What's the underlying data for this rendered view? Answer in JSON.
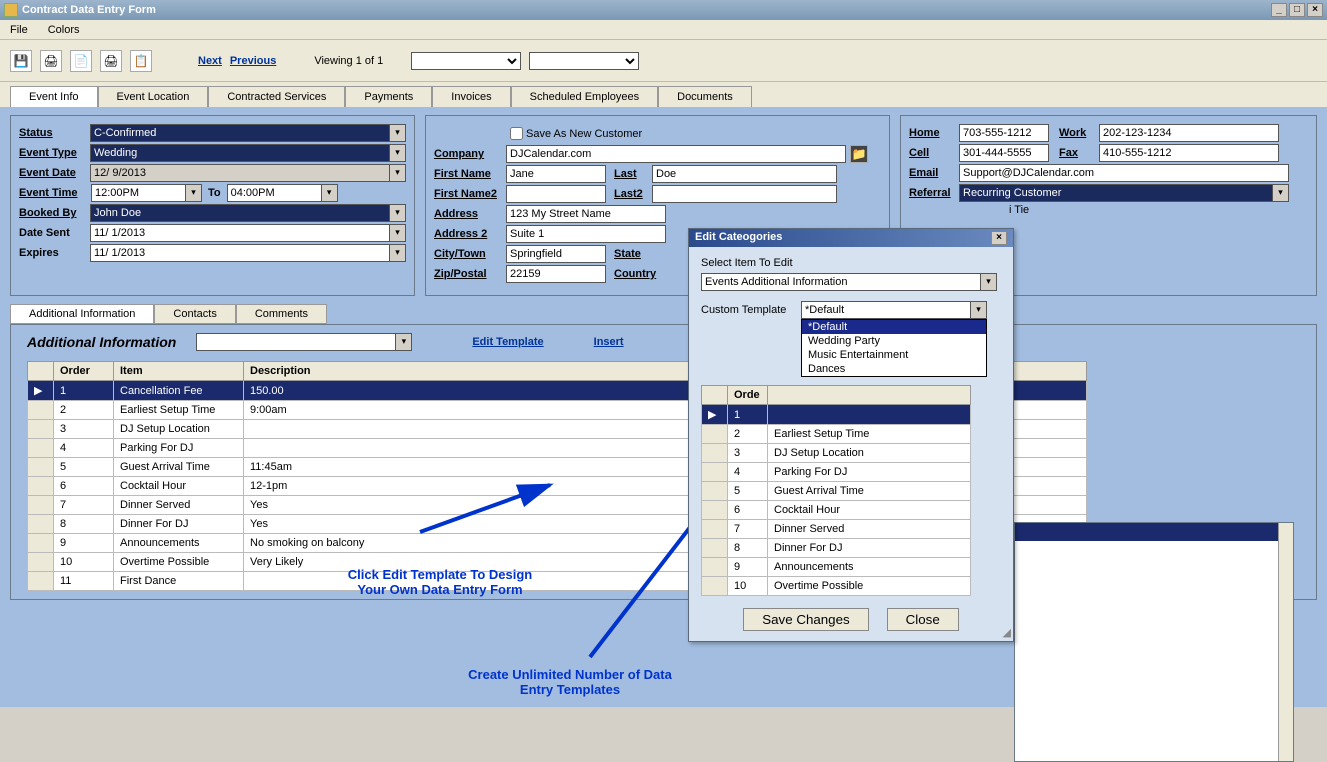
{
  "window": {
    "title": "Contract Data Entry Form"
  },
  "menu": {
    "file": "File",
    "colors": "Colors"
  },
  "toolbar": {
    "next": "Next",
    "previous": "Previous",
    "viewing": "Viewing 1 of 1"
  },
  "tabs": [
    "Event Info",
    "Event Location",
    "Contracted Services",
    "Payments",
    "Invoices",
    "Scheduled Employees",
    "Documents"
  ],
  "left": {
    "status_lbl": "Status",
    "status": "C-Confirmed",
    "eventtype_lbl": "Event Type",
    "eventtype": "Wedding",
    "eventdate_lbl": "Event Date",
    "eventdate": "12/ 9/2013",
    "eventtime_lbl": "Event Time",
    "eventtime_from": "12:00PM",
    "to": "To",
    "eventtime_to": "04:00PM",
    "booked_lbl": "Booked By",
    "booked": "John Doe",
    "datesent_lbl": "Date Sent",
    "datesent": "11/ 1/2013",
    "expires_lbl": "Expires",
    "expires": "11/ 1/2013"
  },
  "mid": {
    "saveas": "Save As New Customer",
    "company_lbl": "Company",
    "company": "DJCalendar.com",
    "first_lbl": "First Name",
    "first": "Jane",
    "last_lbl": "Last",
    "last": "Doe",
    "first2_lbl": "First Name2",
    "first2": "",
    "last2_lbl": "Last2",
    "last2": "",
    "addr_lbl": "Address",
    "addr": "123 My Street Name",
    "addr2_lbl": "Address 2",
    "addr2": "Suite 1",
    "city_lbl": "City/Town",
    "city": "Springfield",
    "state_lbl": "State",
    "zip_lbl": "Zip/Postal",
    "zip": "22159",
    "country_lbl": "Country"
  },
  "right": {
    "home_lbl": "Home",
    "home": "703-555-1212",
    "work_lbl": "Work",
    "work": "202-123-1234",
    "cell_lbl": "Cell",
    "cell": "301-444-5555",
    "fax_lbl": "Fax",
    "fax": "410-555-1212",
    "email_lbl": "Email",
    "email": "Support@DJCalendar.com",
    "referral_lbl": "Referral",
    "referral": "Recurring Customer",
    "tie": "i Tie"
  },
  "subtabs": [
    "Additional Information",
    "Contacts",
    "Comments"
  ],
  "ai": {
    "title": "Additional Information",
    "edit_template": "Edit Template",
    "insert": "Insert",
    "cols": {
      "order": "Order",
      "item": "Item",
      "desc": "Description"
    },
    "rows": [
      {
        "o": "1",
        "i": "Cancellation Fee",
        "d": "150.00"
      },
      {
        "o": "2",
        "i": "Earliest Setup Time",
        "d": "9:00am"
      },
      {
        "o": "3",
        "i": "DJ Setup Location",
        "d": ""
      },
      {
        "o": "4",
        "i": "Parking For DJ",
        "d": ""
      },
      {
        "o": "5",
        "i": "Guest Arrival Time",
        "d": "11:45am"
      },
      {
        "o": "6",
        "i": "Cocktail Hour",
        "d": "12-1pm"
      },
      {
        "o": "7",
        "i": "Dinner Served",
        "d": "Yes"
      },
      {
        "o": "8",
        "i": "Dinner For DJ",
        "d": "Yes"
      },
      {
        "o": "9",
        "i": "Announcements",
        "d": "No smoking on balcony"
      },
      {
        "o": "10",
        "i": "Overtime Possible",
        "d": "Very Likely"
      },
      {
        "o": "11",
        "i": "First Dance",
        "d": ""
      }
    ]
  },
  "dialog": {
    "title": "Edit Cateogories",
    "select_lbl": "Select Item To Edit",
    "select_val": "Events Additional Information",
    "tmpl_lbl": "Custom Template",
    "tmpl_val": "*Default",
    "options": [
      "*Default",
      "Wedding Party",
      "Music Entertainment",
      "Dances"
    ],
    "grid_order": "Orde",
    "grid_rows": [
      {
        "o": "1",
        "i": ""
      },
      {
        "o": "2",
        "i": "Earliest Setup Time"
      },
      {
        "o": "3",
        "i": "DJ Setup Location"
      },
      {
        "o": "4",
        "i": "Parking For DJ"
      },
      {
        "o": "5",
        "i": "Guest Arrival Time"
      },
      {
        "o": "6",
        "i": "Cocktail Hour"
      },
      {
        "o": "7",
        "i": "Dinner Served"
      },
      {
        "o": "8",
        "i": "Dinner For DJ"
      },
      {
        "o": "9",
        "i": "Announcements"
      },
      {
        "o": "10",
        "i": "Overtime Possible"
      }
    ],
    "save": "Save Changes",
    "close": "Close"
  },
  "callouts": {
    "c1": "Click Edit Template To Design\nYour Own Data Entry Form",
    "c2": "Create Unlimited Number of Data\nEntry Templates"
  }
}
